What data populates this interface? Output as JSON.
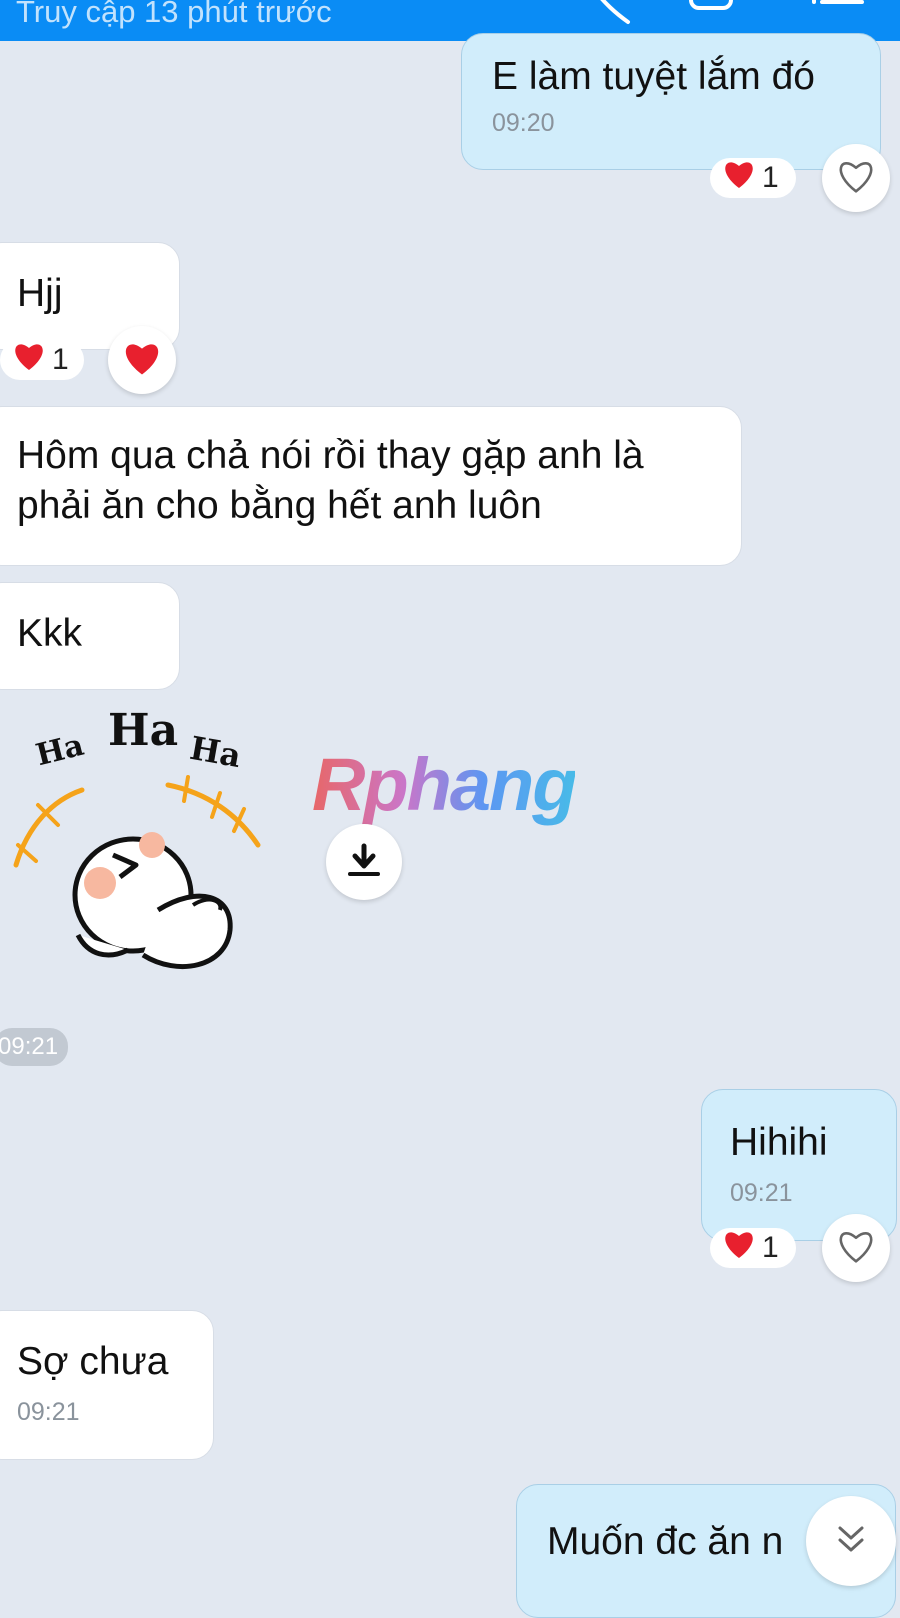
{
  "header": {
    "status": "Truy cập 13 phút trước"
  },
  "messages": {
    "m1": {
      "text": "E làm tuyệt lắm đó",
      "time": "09:20",
      "reaction_count": "1"
    },
    "m2": {
      "text": "Hjj",
      "reaction_count": "1"
    },
    "m3": {
      "text": "Hôm qua chả nói rồi thay gặp anh là phải ăn cho bằng hết anh luôn"
    },
    "m4": {
      "text": "Kkk"
    },
    "sticker": {
      "words": [
        "Ha",
        "Ha",
        "Ha"
      ],
      "time": "09:21"
    },
    "m5": {
      "text": "Hihihi",
      "time": "09:21",
      "reaction_count": "1"
    },
    "m6": {
      "text": "Sợ chưa",
      "time": "09:21"
    },
    "m7": {
      "text": "Muốn đc ăn n"
    }
  },
  "watermark": "Rphang",
  "colors": {
    "header": "#0a8cf5",
    "background": "#e2e8f1",
    "outgoing_bubble": "#d1edfb",
    "incoming_bubble": "#ffffff",
    "heart": "#e8202e"
  },
  "icons": [
    "phone-icon",
    "video-icon",
    "menu-icon",
    "heart-icon",
    "heart-outline-icon",
    "download-icon",
    "scroll-down-icon"
  ]
}
